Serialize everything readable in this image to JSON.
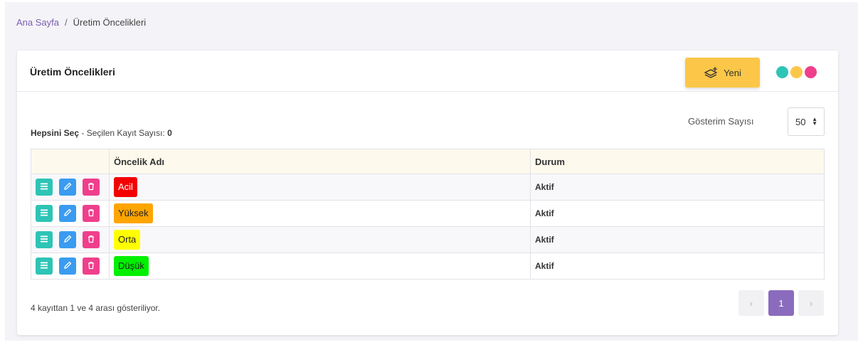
{
  "breadcrumb": {
    "home": "Ana Sayfa",
    "separator": "/",
    "current": "Üretim Öncelikleri"
  },
  "card": {
    "title": "Üretim Öncelikleri",
    "new_button_label": "Yeni",
    "new_button_icon": "layers-plus-icon",
    "dot_colors": [
      "#2ec4b6",
      "#fcc748",
      "#ef3f8c"
    ]
  },
  "selection": {
    "select_all_label": "Hepsini Seç",
    "count_label": " - Seçilen Kayıt Sayısı: ",
    "count_value": "0"
  },
  "page_size": {
    "label": "Gösterim Sayısı",
    "value": "50"
  },
  "table": {
    "headers": [
      "",
      "Öncelik Adı",
      "Durum"
    ],
    "rows": [
      {
        "name": "Acil",
        "badge_bg": "#f40000",
        "badge_fg": "#ffffff",
        "status": "Aktif"
      },
      {
        "name": "Yüksek",
        "badge_bg": "#ffa500",
        "badge_fg": "#222222",
        "status": "Aktif"
      },
      {
        "name": "Orta",
        "badge_bg": "#ffff00",
        "badge_fg": "#222222",
        "status": "Aktif"
      },
      {
        "name": "Düşük",
        "badge_bg": "#00f000",
        "badge_fg": "#222222",
        "status": "Aktif"
      }
    ]
  },
  "footer": {
    "info": "4 kayıttan 1 ve 4 arası gösteriliyor."
  },
  "pagination": {
    "prev": "‹",
    "current": "1",
    "next": "›"
  },
  "colors": {
    "accent_purple": "#8a6bbd",
    "new_button": "#fcc748"
  }
}
